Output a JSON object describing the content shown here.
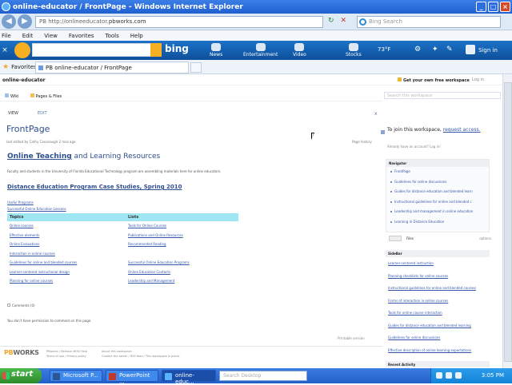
{
  "browser": {
    "window_title": "online-educator / FrontPage - Windows Internet Explorer",
    "url_prefix": "PB  http://onlineeducator.",
    "url_domain": "pbworks.com",
    "search_placeholder": "Bing Search",
    "menu": [
      "File",
      "Edit",
      "View",
      "Favorites",
      "Tools",
      "Help"
    ],
    "favorites_label": "Favorites",
    "tab_title": "PB online-educator / FrontPage"
  },
  "bingbar": {
    "logo_text": "bing",
    "items": [
      {
        "label": "News",
        "icon": "news-icon"
      },
      {
        "label": "Entertainment",
        "icon": "entertainment-icon"
      },
      {
        "label": "Video",
        "icon": "video-icon"
      },
      {
        "label": "Stocks",
        "icon": "stocks-icon"
      }
    ],
    "weather": "73°F",
    "signin": "Sign in"
  },
  "site": {
    "workspace_name": "online-educator",
    "get_workspace": "Get your own free workspace",
    "login": "Log in",
    "tabs": [
      {
        "label": "Wiki",
        "icon": "wiki-icon"
      },
      {
        "label": "Pages & Files",
        "icon": "folder-icon"
      }
    ],
    "search_placeholder": "Search this workspace"
  },
  "page": {
    "view_label": "VIEW",
    "edit_label": "EDIT",
    "close": "x",
    "title": "FrontPage",
    "last_edited": "last edited by  Cathy Cavanaugh  2 mos ago",
    "page_history": "Page history",
    "heading_bold": "Online Teaching",
    "heading_rest": " and Learning Resources",
    "intro": "Faculty and students in the University of Florida Educational Technology program are assembling materials here for online educators.",
    "de_heading": "Distance Education Program Case Studies, Spring 2010",
    "links": [
      "Useful Programs",
      "Successful Online Education Lessons"
    ],
    "table_headers": [
      "Topics",
      "Lists"
    ],
    "table_rows": [
      [
        "Online courses",
        "Tools for Online Courses"
      ],
      [
        "Effective elements",
        "Publications and Online Resources"
      ],
      [
        "Online Evaluations",
        "Recommended Reading"
      ],
      [
        "Interaction in online courses",
        ""
      ],
      [
        "Guidelines for online and blended courses",
        "Successful Online Education Programs"
      ],
      [
        "Learner-centered instructional design",
        "Online Education Contacts"
      ],
      [
        "Planning for online courses",
        "Leadership and Management"
      ]
    ],
    "comments": "Comments (0)",
    "no_permission": "You don't have permission to comment on this page.",
    "printable": "Printable version"
  },
  "footer": {
    "logo_pb": "PB",
    "logo_works": "WORKS",
    "col1": [
      "PBworks / Release 4650  Help",
      "Terms of use / Privacy policy"
    ],
    "col2": [
      "About this workspace",
      "Contact the owner / RSS feed / This workspace is public"
    ]
  },
  "sidebar": {
    "join_text": "To join this workspace,",
    "join_link": "request access.",
    "already": "Already have an account?  Log in!",
    "navigator_title": "Navigator",
    "navigator_items": [
      "FrontPage",
      "Guidelines for online discussions",
      "Guides for distance education and blended learn",
      "Instructional guidelines for online and blended c",
      "Leadership and management in online education",
      "Learning in Distance Education"
    ],
    "new_btn": "",
    "files_label": "Files",
    "options_label": "options",
    "sidebar_title": "SideBar",
    "sidebar_items": [
      "Learner-centered instruction",
      "Planning checklists for online courses",
      "Instructional guidelines for online and blended courses",
      "Forms of interaction in online courses",
      "Tools for online course interaction",
      "Guides for distance education and blended learning",
      "Guidelines for online discussions",
      "Effective description of online learning expectations"
    ],
    "recent_title": "Recent Activity"
  },
  "taskbar": {
    "start": "start",
    "tasks": [
      "Microsoft P...",
      "PowerPoint ...",
      "online-educ..."
    ],
    "search_placeholder": "Search Desktop",
    "clock": "3:05 PM"
  }
}
